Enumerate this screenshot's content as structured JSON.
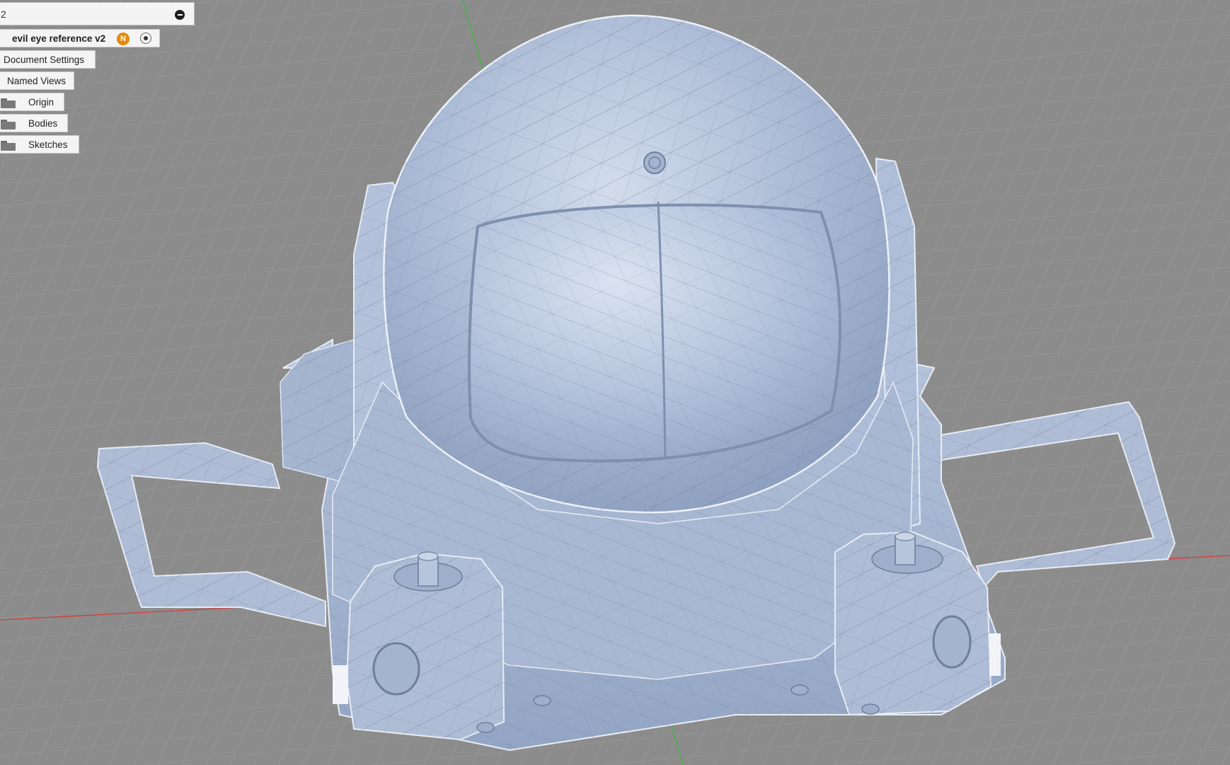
{
  "browser": {
    "header_fragment": "2",
    "document_name": "evil eye reference v2",
    "badge_letter": "N",
    "items": [
      {
        "label": "Document Settings",
        "icon": null
      },
      {
        "label": "Named Views",
        "icon": null
      },
      {
        "label": "Origin",
        "icon": "folder-icon"
      },
      {
        "label": "Bodies",
        "icon": "folder-icon"
      },
      {
        "label": "Sketches",
        "icon": "folder-icon"
      }
    ]
  },
  "colors": {
    "grid_background": "#8c8c8c",
    "model_fill": "#a9b9d3",
    "axis_x": "#d63a3a",
    "axis_y": "#3db83d",
    "badge": "#e28a10"
  }
}
